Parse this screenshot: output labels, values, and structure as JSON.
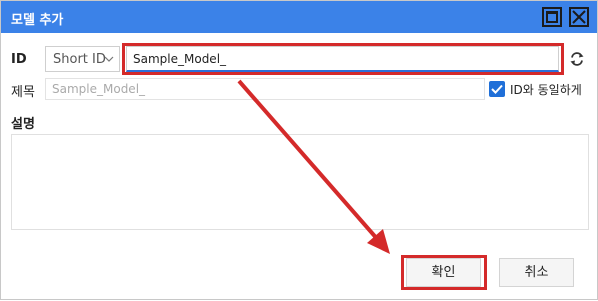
{
  "window": {
    "title": "모델 추가"
  },
  "form": {
    "id_label": "ID",
    "id_type_selected": "Short ID",
    "id_value": "Sample_Model_",
    "title_label": "제목",
    "title_placeholder": "Sample_Model_",
    "same_as_id_label": "ID와 동일하게",
    "same_as_id_checked": true,
    "description_label": "설명",
    "description_value": ""
  },
  "buttons": {
    "ok": "확인",
    "cancel": "취소"
  },
  "icons": {
    "maximize": "maximize-icon",
    "close": "close-icon",
    "chevron": "chevron-down-icon",
    "refresh": "refresh-icon",
    "check": "check-icon"
  },
  "colors": {
    "titlebar": "#3b82e8",
    "checkbox": "#1f6fd8",
    "annotation": "#d42a2a"
  }
}
